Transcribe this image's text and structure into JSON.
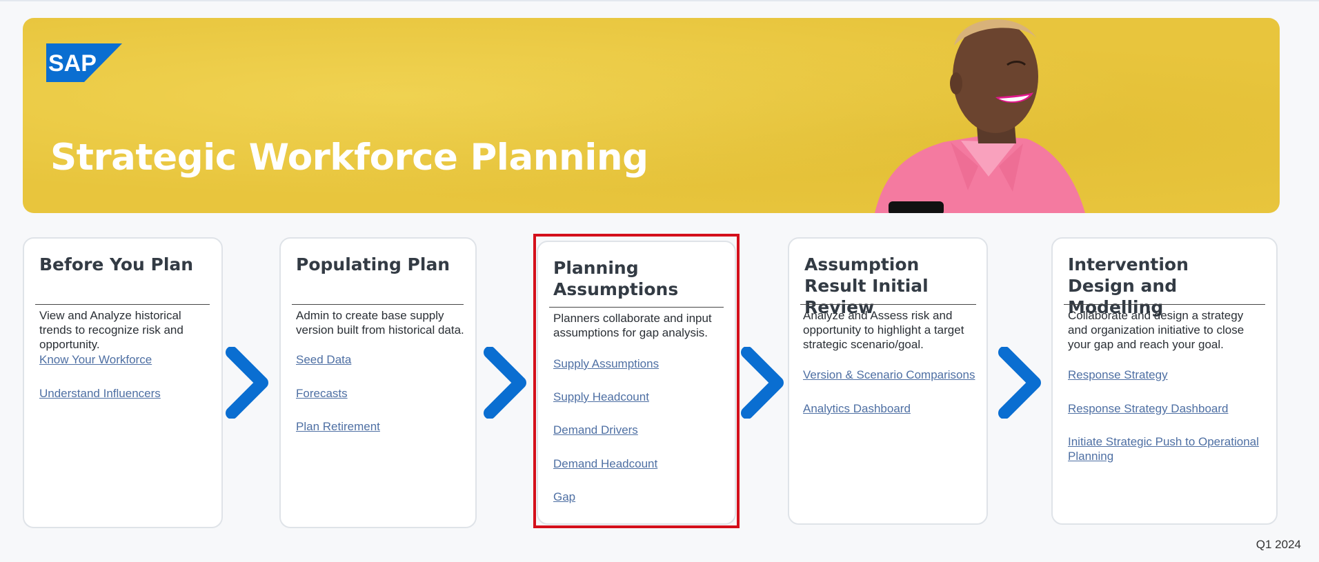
{
  "banner": {
    "logo_text": "SAP",
    "title": "Strategic Workforce Planning",
    "background_color": "#e8c53d"
  },
  "accent_color": "#0a6ed1",
  "highlight_color": "#d4101b",
  "cards": [
    {
      "title": "Before You Plan",
      "description": "View and Analyze historical trends to recognize risk and opportunity.",
      "links": [
        "Know Your Workforce",
        "Understand Influencers"
      ]
    },
    {
      "title": "Populating Plan",
      "description": "Admin to create base supply version built from historical data.",
      "links": [
        "Seed Data",
        "Forecasts",
        "Plan Retirement"
      ]
    },
    {
      "title": "Planning Assumptions",
      "description": "Planners collaborate and input assumptions for gap analysis.",
      "links": [
        "Supply Assumptions",
        "Supply Headcount",
        "Demand Drivers",
        "Demand Headcount",
        "Gap"
      ]
    },
    {
      "title": "Assumption Result Initial Review",
      "description": "Analyze and Assess risk and opportunity to highlight a target strategic scenario/goal.",
      "links": [
        "Version & Scenario Comparisons",
        "Analytics Dashboard"
      ]
    },
    {
      "title": "Intervention Design and Modelling",
      "description": "Collaborate and design a strategy and organization initiative to close your gap and reach your goal.",
      "links": [
        "Response Strategy",
        "Response Strategy Dashboard",
        "Initiate Strategic Push to Operational Planning"
      ]
    }
  ],
  "footer": {
    "date": "Q1 2024"
  },
  "icons": {
    "step_arrow": "chevron-right-icon",
    "logo": "sap-logo"
  }
}
